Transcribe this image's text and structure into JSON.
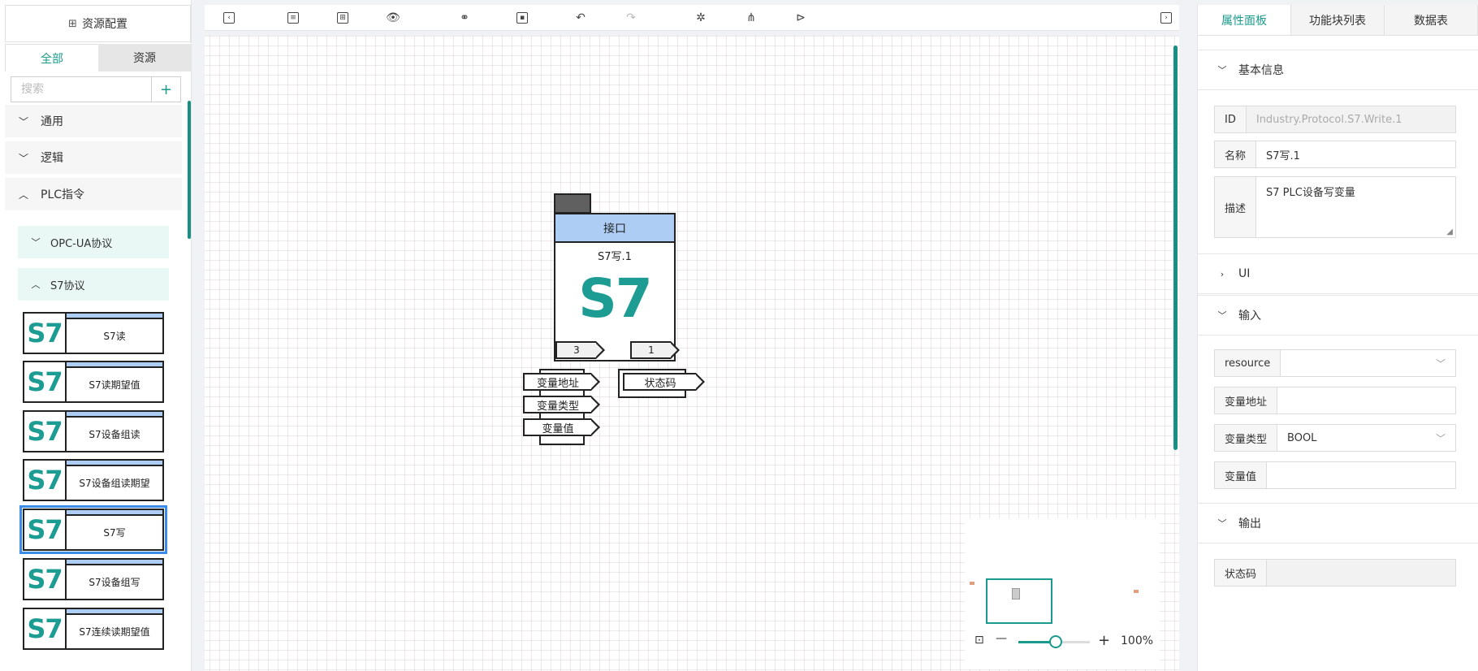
{
  "left": {
    "title": "资源配置",
    "tabs": [
      "全部",
      "资源"
    ],
    "search_placeholder": "搜索",
    "add_symbol": "+",
    "categories": [
      {
        "label": "通用",
        "expanded": false
      },
      {
        "label": "逻辑",
        "expanded": false
      },
      {
        "label": "PLC指令",
        "expanded": true
      }
    ],
    "subcategories": [
      {
        "label": "OPC-UA协议",
        "expanded": false
      },
      {
        "label": "S7协议",
        "expanded": true
      }
    ],
    "block_logo": "S7",
    "blocks": [
      "S7读",
      "S7读期望值",
      "S7设备组读",
      "S7设备组读期望",
      "S7写",
      "S7设备组写",
      "S7连续读期望值"
    ],
    "selected_block": "S7写"
  },
  "toolbar": {
    "icons": [
      "collapse-left-icon",
      "settings-icon",
      "layout-icon",
      "preview-icon",
      "link-icon",
      "save-icon",
      "undo-icon",
      "redo-icon",
      "debug-icon",
      "network-icon",
      "run-icon",
      "collapse-right-icon"
    ]
  },
  "canvas": {
    "node": {
      "header": "接口",
      "name": "S7写.1",
      "logo": "S7",
      "input_count": "3",
      "output_count": "1",
      "inputs": [
        "变量地址",
        "变量类型",
        "变量值"
      ],
      "outputs": [
        "状态码"
      ]
    },
    "minimap": {
      "zoom": "100%",
      "zoom_level_pct": 50
    }
  },
  "right": {
    "tabs": [
      "属性面板",
      "功能块列表",
      "数据表"
    ],
    "sections": {
      "basic": "基本信息",
      "ui": "UI",
      "input": "输入",
      "output": "输出"
    },
    "fields": {
      "id": {
        "label": "ID",
        "value": "Industry.Protocol.S7.Write.1"
      },
      "name": {
        "label": "名称",
        "value": "S7写.1"
      },
      "desc": {
        "label": "描述",
        "value": "S7 PLC设备写变量"
      },
      "resource": {
        "label": "resource",
        "value": ""
      },
      "var_addr": {
        "label": "变量地址",
        "value": ""
      },
      "var_type": {
        "label": "变量类型",
        "value": "BOOL"
      },
      "var_val": {
        "label": "变量值",
        "value": ""
      },
      "status": {
        "label": "状态码",
        "value": ""
      }
    }
  }
}
